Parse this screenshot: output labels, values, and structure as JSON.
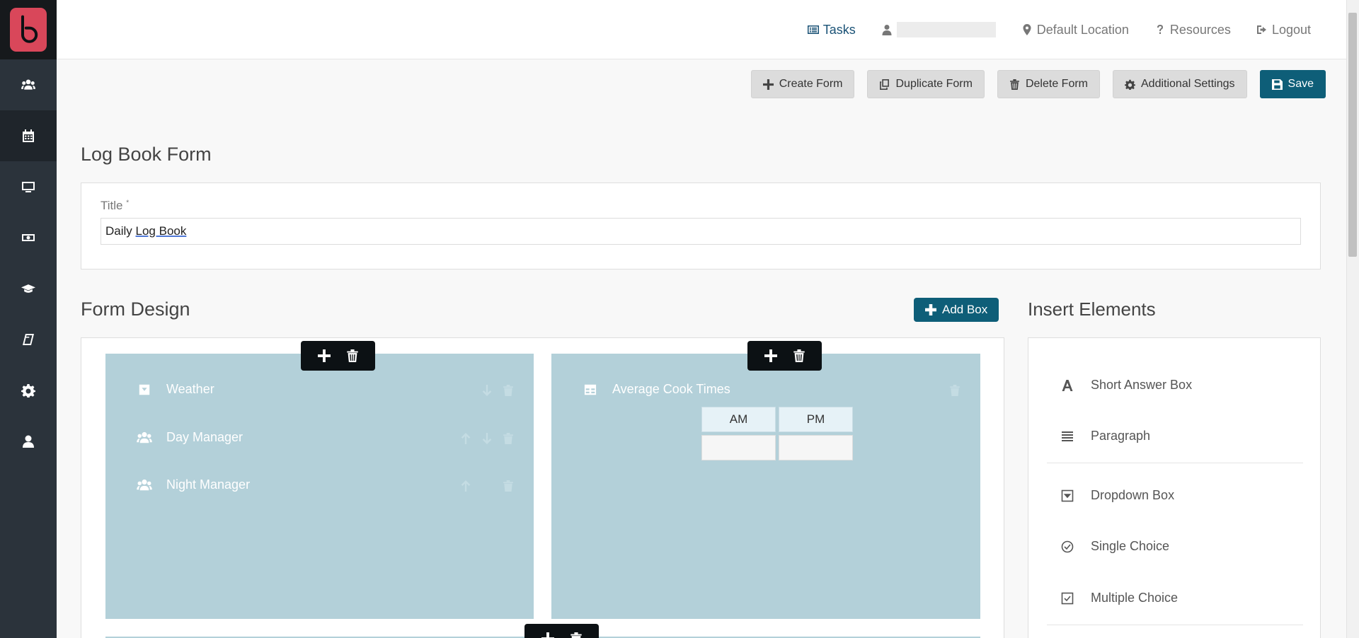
{
  "topnav": {
    "tasks": "Tasks",
    "user_name": "",
    "location": "Default Location",
    "resources": "Resources",
    "logout": "Logout"
  },
  "toolbar": {
    "create": "Create Form",
    "duplicate": "Duplicate Form",
    "delete": "Delete Form",
    "settings": "Additional Settings",
    "save": "Save"
  },
  "page": {
    "heading": "Log Book Form",
    "title_label": "Title",
    "title_required": "*",
    "title_value_part1": "Daily ",
    "title_value_part2": "Log Book"
  },
  "design": {
    "heading": "Form Design",
    "add_box": "Add Box",
    "box1": {
      "fields": [
        {
          "label": "Weather",
          "icon": "dropdown-icon"
        },
        {
          "label": "Day Manager",
          "icon": "users-icon"
        },
        {
          "label": "Night Manager",
          "icon": "users-icon"
        }
      ]
    },
    "box2": {
      "field": "Average Cook Times",
      "columns": [
        "AM",
        "PM"
      ]
    }
  },
  "insert": {
    "heading": "Insert Elements",
    "items": [
      {
        "label": "Short Answer Box",
        "icon": "text-icon"
      },
      {
        "label": "Paragraph",
        "icon": "paragraph-icon"
      },
      {
        "label": "Dropdown Box",
        "icon": "dropdown-icon"
      },
      {
        "label": "Single Choice",
        "icon": "check-circle-icon"
      },
      {
        "label": "Multiple Choice",
        "icon": "check-square-icon"
      }
    ]
  },
  "colors": {
    "sidebar": "#2b333b",
    "logo": "#d9475a",
    "primary": "#0e5e78",
    "box": "#b3d0d9"
  }
}
